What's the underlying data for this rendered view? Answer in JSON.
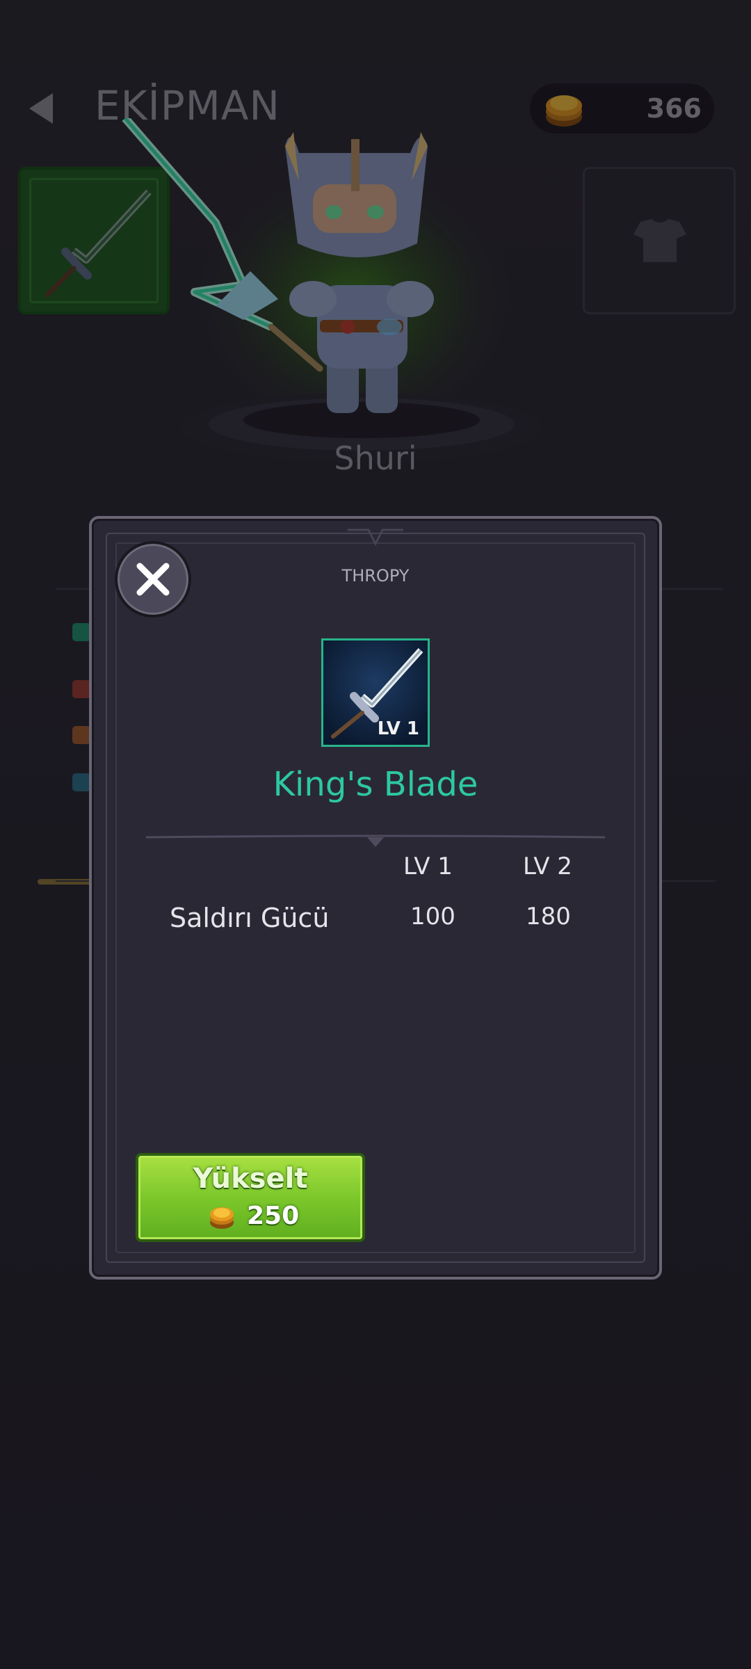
{
  "header": {
    "title": "EKİPMAN",
    "back_icon": "back-arrow-icon",
    "coins": "366",
    "coin_icon": "gold-coin-icon"
  },
  "equipment_slots": {
    "weapon_icon": "sword-icon",
    "armor_icon": "armor-icon"
  },
  "character": {
    "name": "Shuri"
  },
  "modal": {
    "category": "THROPY",
    "close_icon": "close-icon",
    "item": {
      "name": "King's Blade",
      "level_badge": "LV 1",
      "icon": "sword-icon"
    },
    "stats": {
      "columns": [
        "LV 1",
        "LV 2"
      ],
      "rows": [
        {
          "label": "Saldırı Gücü",
          "values": [
            "100",
            "180"
          ]
        }
      ]
    },
    "upgrade": {
      "label": "Yükselt",
      "cost": "250",
      "coin_icon": "gold-coin-icon"
    }
  },
  "colors": {
    "accent_teal": "#2cc9a2",
    "upgrade_green": "#7cc82b",
    "background": "#231f29"
  }
}
